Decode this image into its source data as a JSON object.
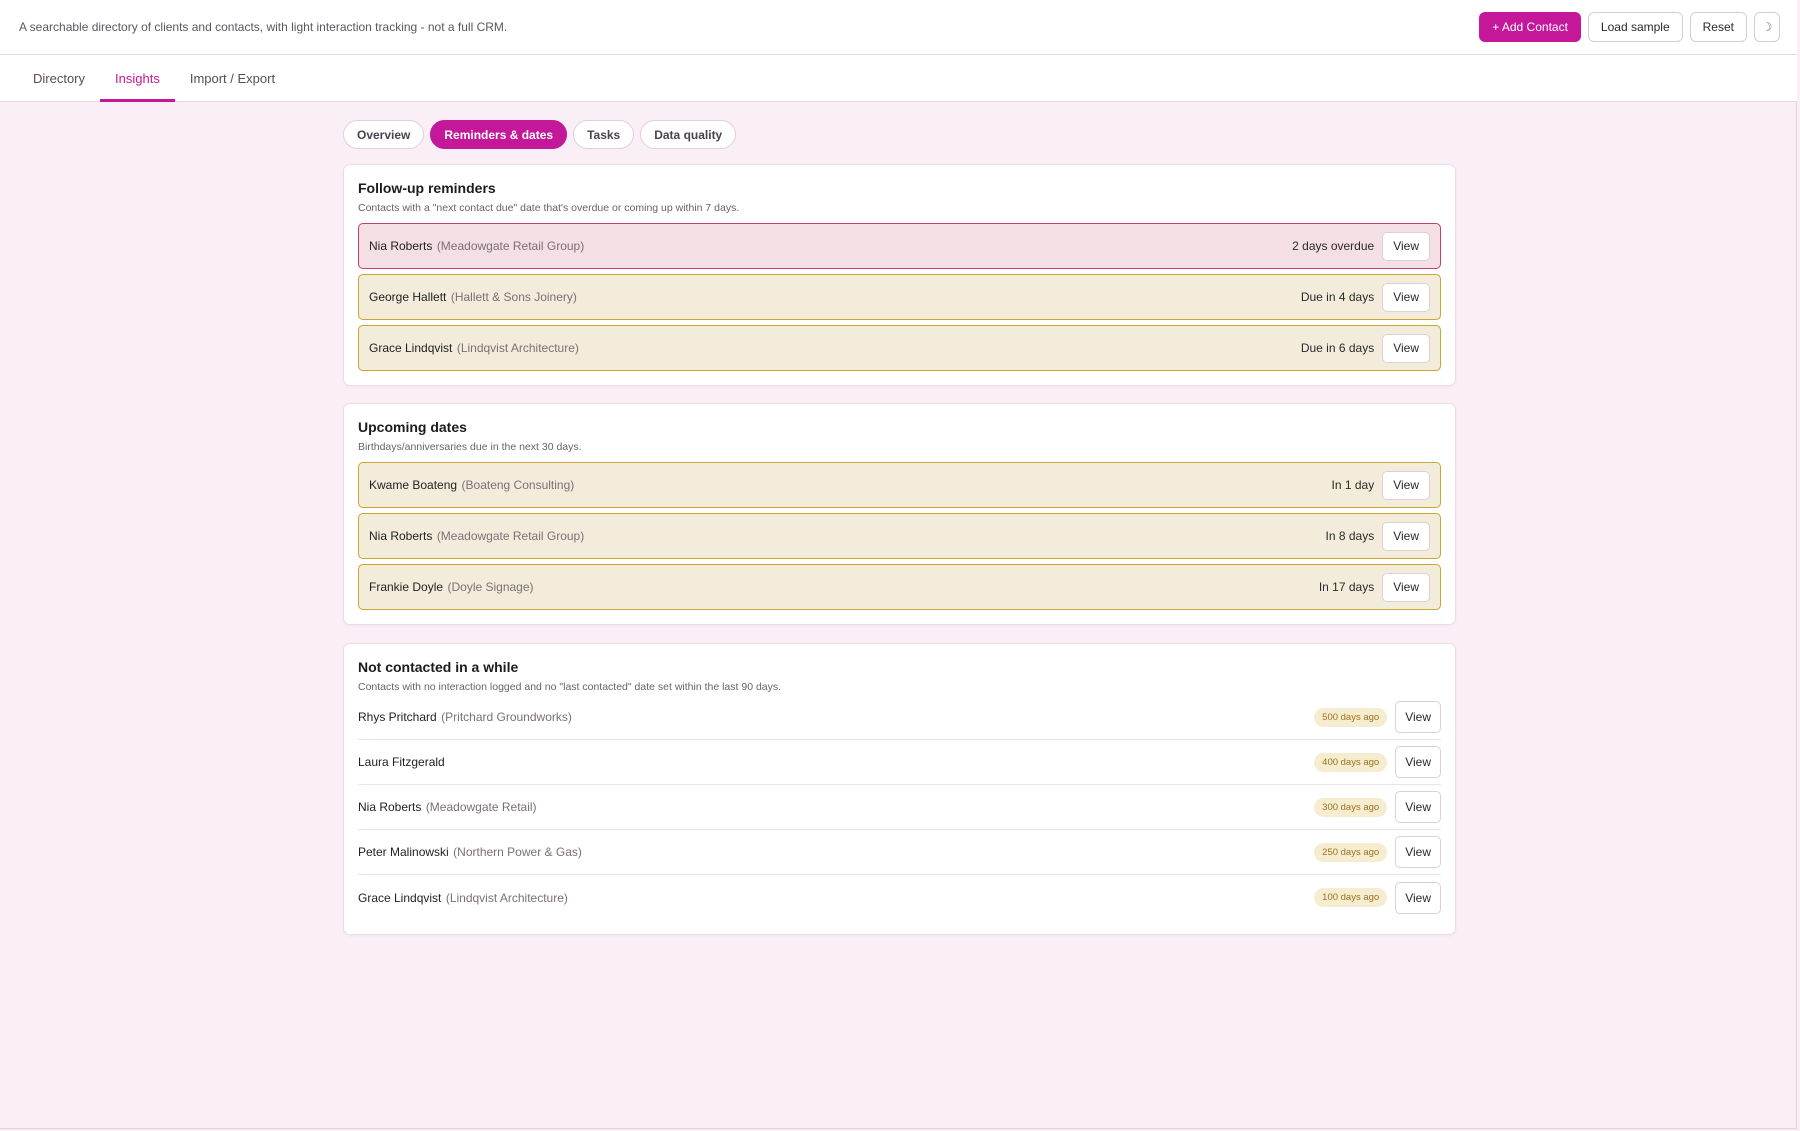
{
  "header": {
    "tagline": "A searchable directory of clients and contacts, with light interaction tracking - not a full CRM.",
    "add_contact": "+ Add Contact",
    "load_sample": "Load sample",
    "reset": "Reset",
    "theme_toggle": "☽"
  },
  "tabs": [
    "Directory",
    "Insights",
    "Import / Export"
  ],
  "active_tab": "Insights",
  "subtabs": [
    "Overview",
    "Reminders & dates",
    "Tasks",
    "Data quality"
  ],
  "active_subtab": "Reminders & dates",
  "view_label": "View",
  "followup": {
    "title": "Follow-up reminders",
    "description": "Contacts with a \"next contact due\" date that's overdue or coming up within 7 days.",
    "rows": [
      {
        "name": "Nia Roberts",
        "company": "(Meadowgate Retail Group)",
        "status": "2 days overdue",
        "state": "overdue"
      },
      {
        "name": "George Hallett",
        "company": "(Hallett & Sons Joinery)",
        "status": "Due in 4 days",
        "state": "due"
      },
      {
        "name": "Grace Lindqvist",
        "company": "(Lindqvist Architecture)",
        "status": "Due in 6 days",
        "state": "due"
      }
    ]
  },
  "upcoming": {
    "title": "Upcoming dates",
    "description": "Birthdays/anniversaries due in the next 30 days.",
    "rows": [
      {
        "name": "Kwame Boateng",
        "company": "(Boateng Consulting)",
        "status": "In 1 day",
        "state": "due"
      },
      {
        "name": "Nia Roberts",
        "company": "(Meadowgate Retail Group)",
        "status": "In 8 days",
        "state": "due"
      },
      {
        "name": "Frankie Doyle",
        "company": "(Doyle Signage)",
        "status": "In 17 days",
        "state": "due"
      }
    ]
  },
  "not_contacted": {
    "title": "Not contacted in a while",
    "description": "Contacts with no interaction logged and no \"last contacted\" date set within the last 90 days.",
    "rows": [
      {
        "name": "Rhys Pritchard",
        "company": "(Pritchard Groundworks)",
        "badge": "500 days ago"
      },
      {
        "name": "Laura Fitzgerald",
        "company": "",
        "badge": "400 days ago"
      },
      {
        "name": "Nia Roberts",
        "company": "(Meadowgate Retail)",
        "badge": "300 days ago"
      },
      {
        "name": "Peter Malinowski",
        "company": "(Northern Power & Gas)",
        "badge": "250 days ago"
      },
      {
        "name": "Grace Lindqvist",
        "company": "(Lindqvist Architecture)",
        "badge": "100 days ago"
      }
    ]
  },
  "colors": {
    "accent": "#c4179a",
    "background": "#faeef7",
    "overdue_border": "#c23e6e",
    "due_border": "#c9a630"
  }
}
